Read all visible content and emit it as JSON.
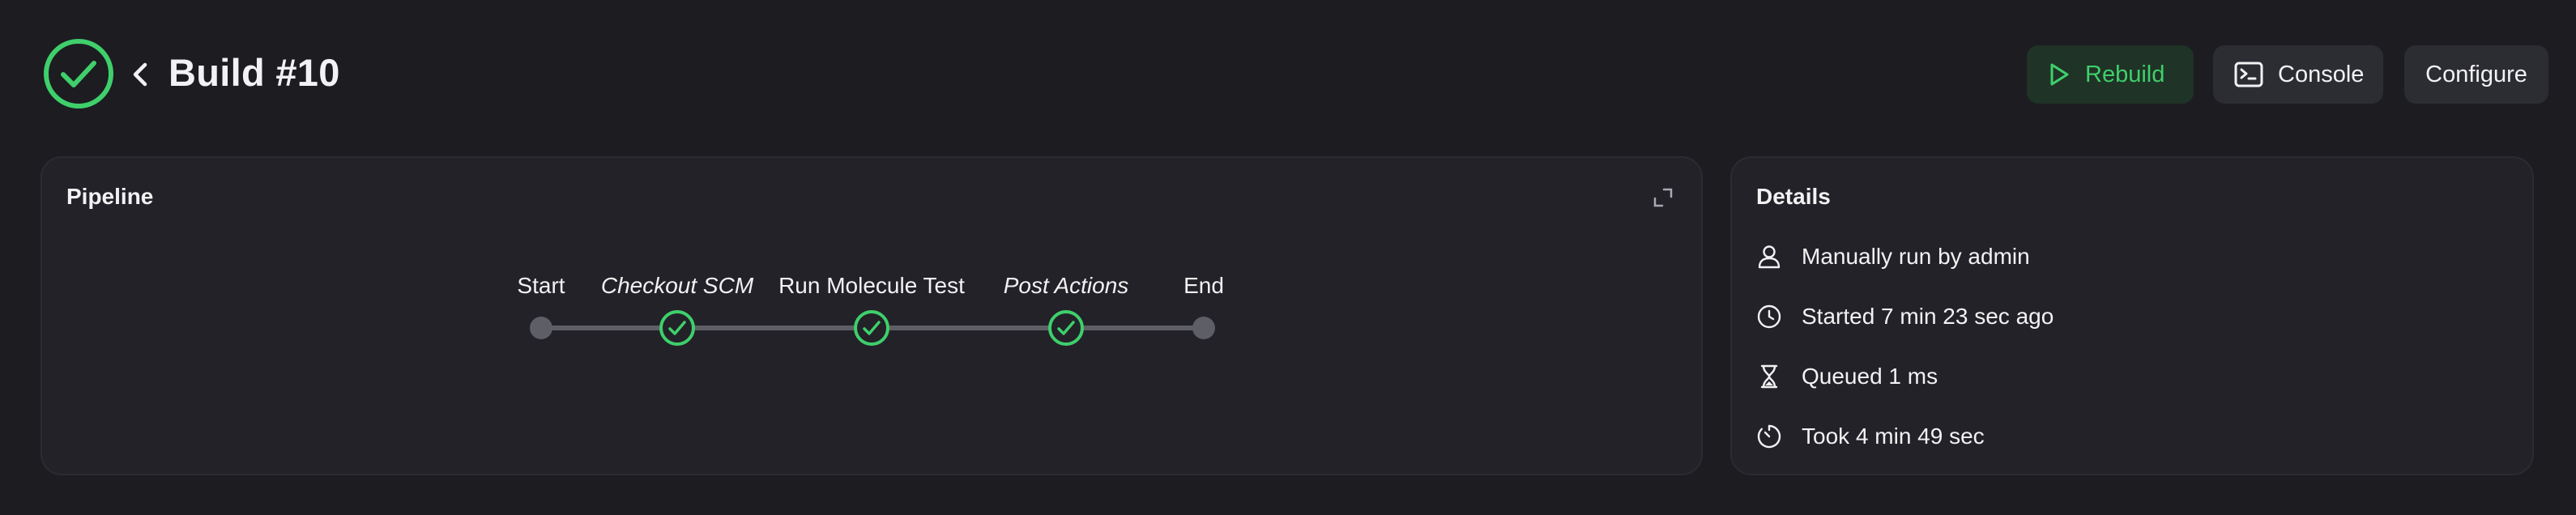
{
  "header": {
    "title": "Build #10",
    "status": "success",
    "status_icon": "check-circle-icon",
    "back_icon": "chevron-left-icon"
  },
  "actions": {
    "rebuild_label": "Rebuild",
    "console_label": "Console",
    "configure_label": "Configure"
  },
  "pipeline": {
    "title": "Pipeline",
    "stages": [
      {
        "label": "Start",
        "italic": false,
        "status": "boundary"
      },
      {
        "label": "Checkout SCM",
        "italic": true,
        "status": "success"
      },
      {
        "label": "Run Molecule Test",
        "italic": false,
        "status": "success"
      },
      {
        "label": "Post Actions",
        "italic": true,
        "status": "success"
      },
      {
        "label": "End",
        "italic": false,
        "status": "boundary"
      }
    ]
  },
  "details": {
    "title": "Details",
    "items": [
      {
        "icon": "user-icon",
        "text": "Manually run by admin"
      },
      {
        "icon": "clock-icon",
        "text": "Started 7 min 23 sec ago"
      },
      {
        "icon": "hourglass-icon",
        "text": "Queued 1 ms"
      },
      {
        "icon": "timer-icon",
        "text": "Took 4 min 49 sec"
      }
    ]
  },
  "colors": {
    "background": "#1c1c21",
    "card": "#222228",
    "success": "#3fcf6b",
    "button": "#2c2c33",
    "rebuild_bg": "#1f3326"
  }
}
